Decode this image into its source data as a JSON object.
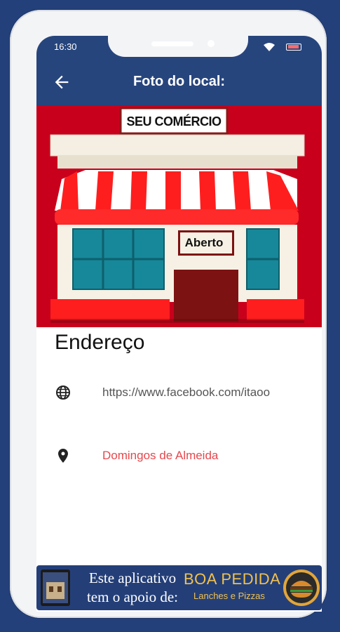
{
  "status_bar": {
    "time": "16:30"
  },
  "app_bar": {
    "title": "Foto do local:"
  },
  "photo": {
    "sign": "SEU COMÉRCIO",
    "door_sign": "Aberto"
  },
  "section": {
    "title": "Endereço"
  },
  "info": {
    "website": "https://www.facebook.com/itaoo",
    "address": "Domingos de Almeida"
  },
  "banner": {
    "line1": "Este aplicativo",
    "line2": "tem o apoio de:",
    "brand_name": "BOA PEDIDA",
    "brand_tagline": "Lanches e Pizzas"
  },
  "colors": {
    "primary": "#27457d",
    "link": "#e5484d",
    "brand": "#f2c14e",
    "hero_bg": "#c9001c"
  },
  "icons": {
    "back": "arrow-left-icon",
    "web": "globe-icon",
    "location": "map-pin-icon",
    "wifi": "wifi-icon",
    "battery": "battery-icon"
  }
}
